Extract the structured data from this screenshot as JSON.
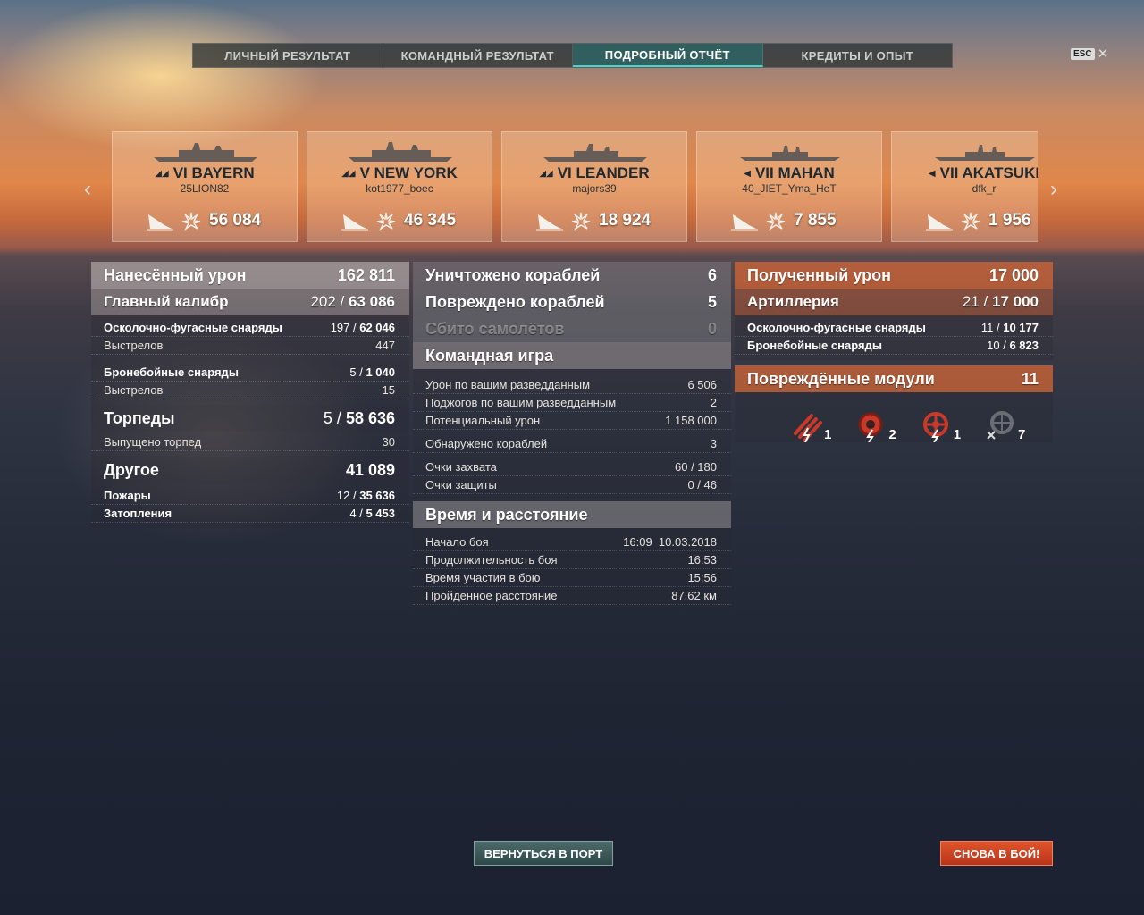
{
  "tabs": [
    "ЛИЧНЫЙ РЕЗУЛЬТАТ",
    "КОМАНДНЫЙ РЕЗУЛЬТАТ",
    "ПОДРОБНЫЙ ОТЧЁТ",
    "КРЕДИТЫ И ОПЫТ"
  ],
  "active_tab": "ПОДРОБНЫЙ ОТЧЁТ",
  "esc_label": "ESC",
  "ships": [
    {
      "name": "VI BAYERN",
      "player": "25LION82",
      "damage": "56 084"
    },
    {
      "name": "V NEW YORK",
      "player": "kot1977_boec",
      "damage": "46 345"
    },
    {
      "name": "VI LEANDER",
      "player": "majors39",
      "damage": "18 924"
    },
    {
      "name": "VII MAHAN",
      "player": "40_JIET_Yma_HeT",
      "damage": "7 855"
    },
    {
      "name": "VII AKATSUKI",
      "player": "dfk_r",
      "damage": "1 956"
    }
  ],
  "dealt": {
    "title": "Нанесённый урон",
    "total": "162 811",
    "main": {
      "label": "Главный калибр",
      "hits": "202",
      "value": "63 086"
    },
    "he": {
      "label": "Осколочно-фугасные снаряды",
      "hits": "197",
      "value": "62 046"
    },
    "he_shots": {
      "label": "Выстрелов",
      "value": "447"
    },
    "ap": {
      "label": "Бронебойные снаряды",
      "hits": "5",
      "value": "1 040"
    },
    "ap_shots": {
      "label": "Выстрелов",
      "value": "15"
    },
    "torp": {
      "label": "Торпеды",
      "hits": "5",
      "value": "58 636"
    },
    "torp_fired": {
      "label": "Выпущено торпед",
      "value": "30"
    },
    "other": {
      "label": "Другое",
      "value": "41 089"
    },
    "fires": {
      "label": "Пожары",
      "hits": "12",
      "value": "35 636"
    },
    "floods": {
      "label": "Затопления",
      "hits": "4",
      "value": "5 453"
    }
  },
  "middle": {
    "destroyed": {
      "label": "Уничтожено кораблей",
      "value": "6"
    },
    "damaged": {
      "label": "Повреждено кораблей",
      "value": "5"
    },
    "planes": {
      "label": "Сбито самолётов",
      "value": "0"
    },
    "team_title": "Командная игра",
    "team": [
      {
        "label": "Урон по вашим разведданным",
        "value": "6 506"
      },
      {
        "label": "Поджогов по вашим разведданным",
        "value": "2"
      },
      {
        "label": "Потенциальный урон",
        "value": "1 158 000"
      },
      {
        "label": "Обнаружено кораблей",
        "value": "3"
      },
      {
        "label": "Очки захвата",
        "value": "60 / 180"
      },
      {
        "label": "Очки защиты",
        "value": "0 / 46"
      }
    ],
    "time_title": "Время и расстояние",
    "time": [
      {
        "label": "Начало боя",
        "value": "16:09  10.03.2018"
      },
      {
        "label": "Продолжительность боя",
        "value": "16:53"
      },
      {
        "label": "Время участия в бою",
        "value": "15:56"
      },
      {
        "label": "Пройденное расстояние",
        "value": "87.62 км"
      }
    ]
  },
  "received": {
    "title": "Полученный урон",
    "total": "17 000",
    "art": {
      "label": "Артиллерия",
      "hits": "21",
      "value": "17 000"
    },
    "he": {
      "label": "Осколочно-фугасные снаряды",
      "hits": "11",
      "value": "10 177"
    },
    "ap": {
      "label": "Бронебойные снаряды",
      "hits": "10",
      "value": "6 823"
    },
    "modules_title": "Повреждённые модули",
    "modules_total": "11",
    "modules": [
      {
        "icon": "torpedo-tubes-icon",
        "count": "1"
      },
      {
        "icon": "engine-icon",
        "count": "2"
      },
      {
        "icon": "steering-gear-icon",
        "count": "1"
      },
      {
        "icon": "destroyed-module-icon",
        "count": "7"
      }
    ]
  },
  "buttons": {
    "port": "ВЕРНУТЬСЯ В ПОРТ",
    "battle": "СНОВА В БОЙ!"
  },
  "colors": {
    "accent_teal": "#4fd2c8",
    "battle_button": "#d8472a",
    "received_header": "#cd6437"
  }
}
